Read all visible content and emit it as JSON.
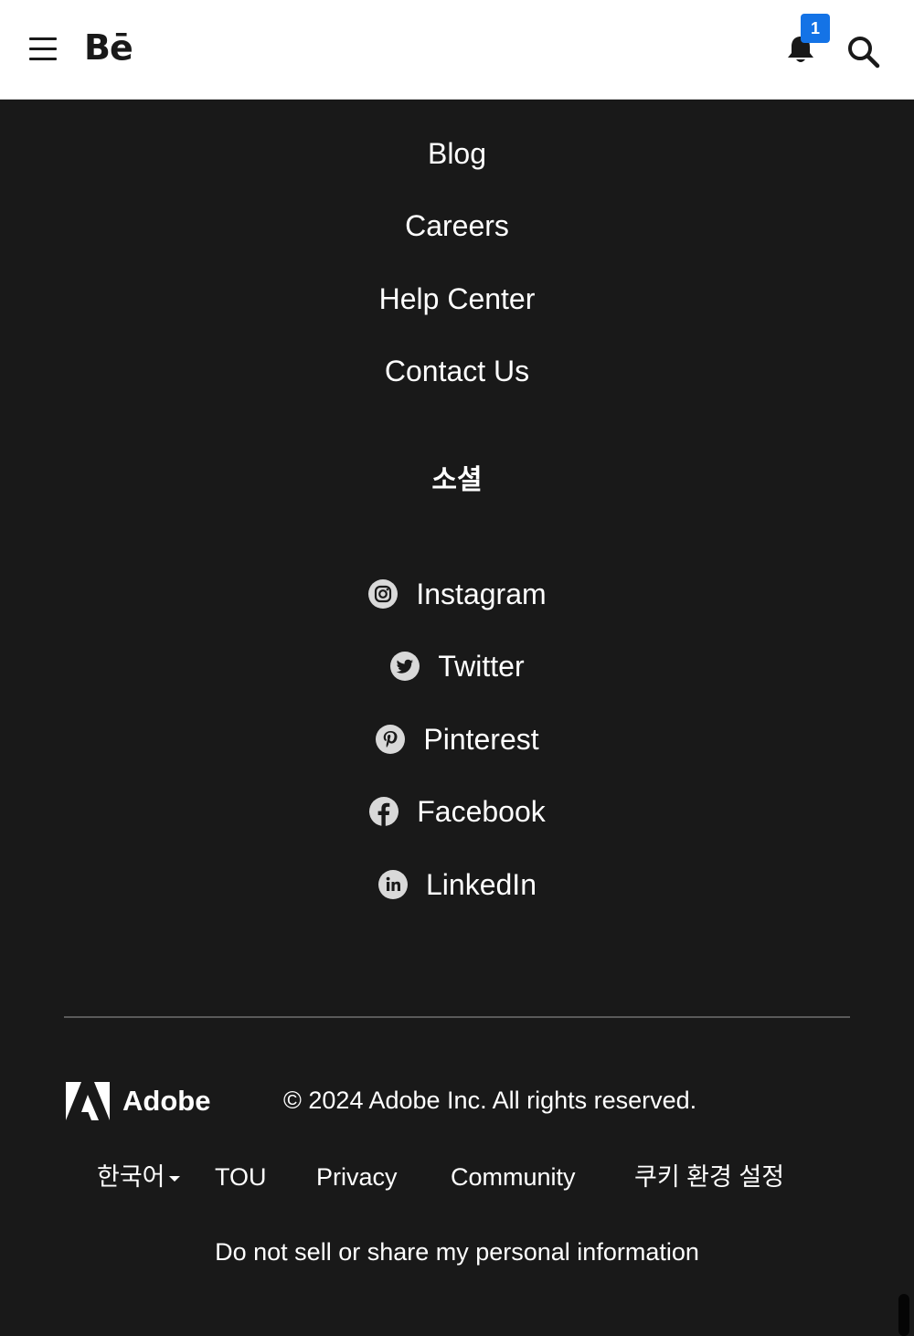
{
  "header": {
    "logo_text": "Bē",
    "notification_count": "1",
    "accent_color": "#1473e6"
  },
  "footer_links": [
    "Blog",
    "Careers",
    "Help Center",
    "Contact Us"
  ],
  "social": {
    "title": "소셜",
    "items": [
      {
        "label": "Instagram",
        "icon": "instagram-icon"
      },
      {
        "label": "Twitter",
        "icon": "twitter-icon"
      },
      {
        "label": "Pinterest",
        "icon": "pinterest-icon"
      },
      {
        "label": "Facebook",
        "icon": "facebook-icon"
      },
      {
        "label": "LinkedIn",
        "icon": "linkedin-icon"
      }
    ]
  },
  "legal": {
    "brand": "Adobe",
    "copyright": "© 2024 Adobe Inc. All rights reserved.",
    "language": "한국어",
    "links": [
      "TOU",
      "Privacy",
      "Community",
      "쿠키 환경 설정"
    ],
    "privacy_info": "Do not sell or share my personal information"
  }
}
